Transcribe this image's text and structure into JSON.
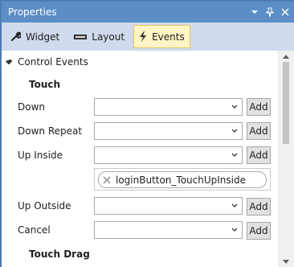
{
  "window": {
    "title": "Properties"
  },
  "title_buttons": {
    "dropdown": "▾",
    "pin": "📌",
    "close": "✕"
  },
  "tabs": [
    {
      "label": "Widget",
      "icon": "wrench-icon"
    },
    {
      "label": "Layout",
      "icon": "layout-icon"
    },
    {
      "label": "Events",
      "icon": "lightning-icon",
      "active": true
    }
  ],
  "panel": {
    "section": "Control Events",
    "group_touch": "Touch",
    "group_touch_drag": "Touch Drag",
    "rows": [
      {
        "label": "Down",
        "value": ""
      },
      {
        "label": "Down Repeat",
        "value": ""
      },
      {
        "label": "Up Inside",
        "value": ""
      },
      {
        "label": "Up Outside",
        "value": ""
      },
      {
        "label": "Cancel",
        "value": ""
      }
    ],
    "add_label": "Add",
    "handler_chip": "loginButton_TouchUpInside"
  },
  "colors": {
    "titlebar": "#5b8ec5",
    "toolbar": "#cfdaec",
    "active_tab": "#fff4c4",
    "active_tab_border": "#e5c365"
  }
}
